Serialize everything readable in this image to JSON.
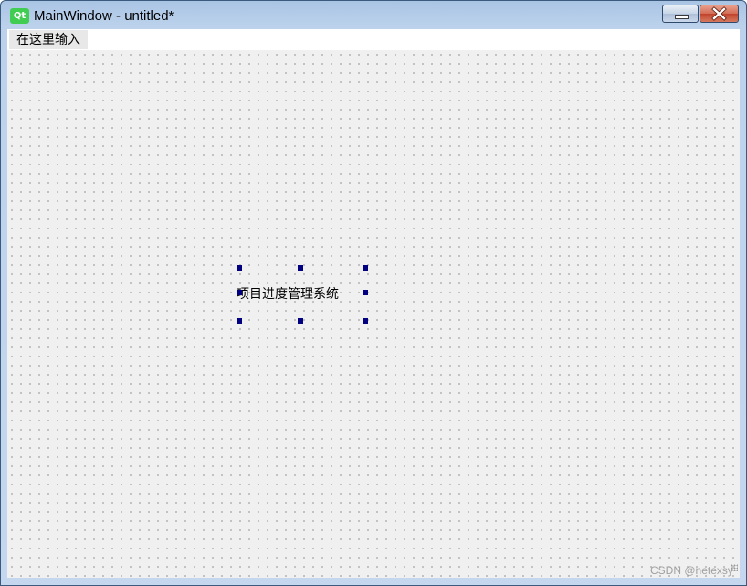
{
  "window": {
    "title": "MainWindow - untitled*",
    "app_logo": "Qt",
    "controls": {
      "minimize_icon": "minimize-icon",
      "close_icon": "close-icon"
    }
  },
  "menubar": {
    "items": [
      {
        "label": "在这里输入"
      }
    ]
  },
  "form": {
    "label": {
      "text": "项目进度管理系统"
    }
  },
  "watermark": "CSDN @netexsy",
  "colors": {
    "handle": "#000080",
    "close_button": "#c8492f",
    "qt_green": "#41cd52",
    "canvas": "#f0f0f0"
  }
}
